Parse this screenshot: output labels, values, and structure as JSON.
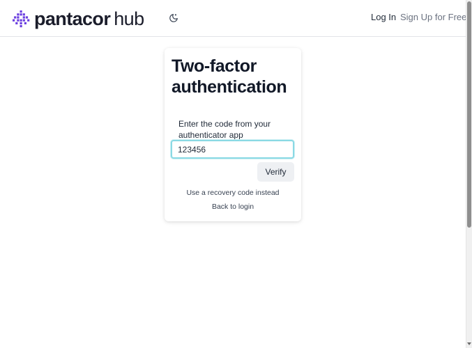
{
  "header": {
    "brand_name": "pantacor",
    "brand_suffix": "hub",
    "brand_color": "#6b3fe0",
    "theme_toggle_icon": "moon-icon",
    "nav": {
      "login_label": "Log In",
      "signup_label": "Sign Up for Free"
    }
  },
  "card": {
    "title": "Two-factor authentication",
    "field_label": "Enter the code from your authenticator app",
    "code_value": "123456",
    "verify_label": "Verify",
    "recovery_link": "Use a recovery code instead",
    "back_link": "Back to login",
    "focus_color": "#8ad9e4"
  }
}
